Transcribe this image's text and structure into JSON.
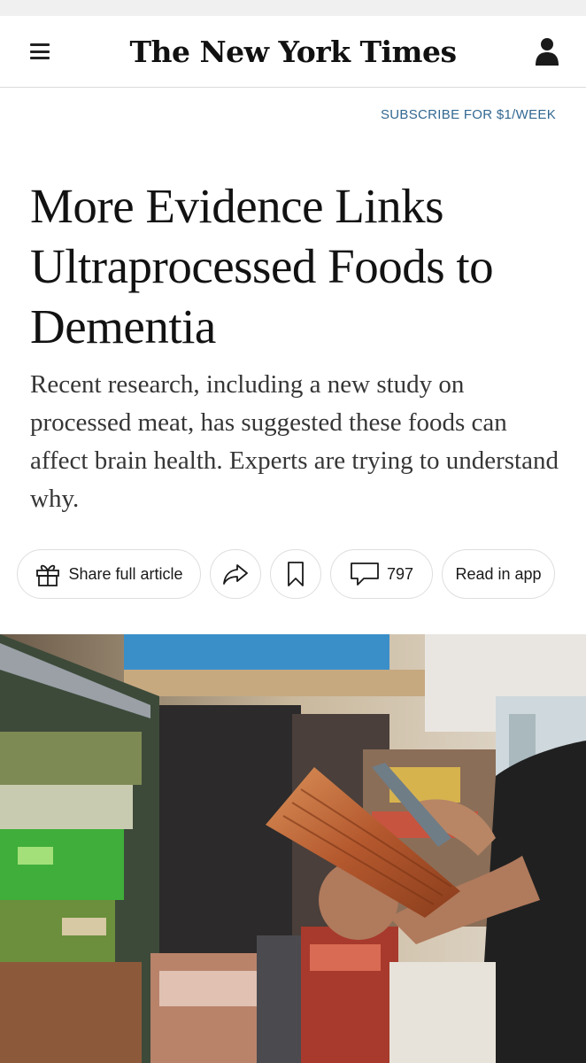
{
  "header": {
    "logo_text": "The New York Times",
    "menu_icon": "hamburger-menu-icon",
    "account_icon": "person-icon"
  },
  "subscribe": {
    "label": "SUBSCRIBE FOR $1/WEEK"
  },
  "article": {
    "headline": "More Evidence Links Ultraprocessed Foods to Dementia",
    "summary": "Recent research, including a new study on processed meat, has suggested these foods can affect brain health. Experts are trying to understand why."
  },
  "actions": {
    "share_label": "Share full article",
    "share_icon": "gift-icon",
    "forward_icon": "share-arrow-icon",
    "bookmark_icon": "bookmark-icon",
    "comments_count": "797",
    "comments_icon": "comment-icon",
    "read_in_app_label": "Read in app"
  },
  "photo": {
    "description_icon": "grocery-store-photo",
    "colors": {
      "link": "#326891"
    }
  }
}
